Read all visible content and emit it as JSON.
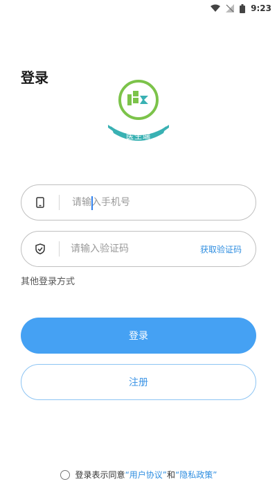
{
  "status_bar": {
    "time": "9:23"
  },
  "page": {
    "title": "登录"
  },
  "logo": {
    "badge_text": "医生端"
  },
  "phone_field": {
    "placeholder": "请输入手机号"
  },
  "code_field": {
    "placeholder": "请输入验证码",
    "get_code_label": "获取验证码"
  },
  "other_login": "其他登录方式",
  "login_button": "登录",
  "register_button": "注册",
  "agreement": {
    "prefix": "登录表示同意",
    "user_agreement": "“用户协议”",
    "and": "和",
    "privacy_policy": "“隐私政策”"
  },
  "colors": {
    "primary": "#45a1f3",
    "link": "#2f8ee0",
    "logo_green": "#7cc34a",
    "logo_teal": "#39b1b3"
  }
}
